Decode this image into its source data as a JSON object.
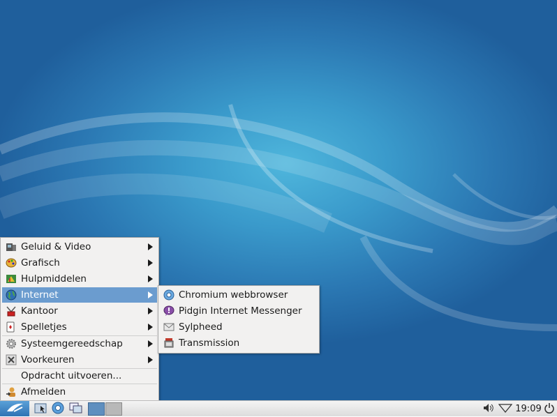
{
  "menu": {
    "items": [
      {
        "label": "Geluid & Video",
        "icon": "multimedia-icon",
        "submenu": true
      },
      {
        "label": "Grafisch",
        "icon": "graphics-icon",
        "submenu": true
      },
      {
        "label": "Hulpmiddelen",
        "icon": "accessories-icon",
        "submenu": true
      },
      {
        "label": "Internet",
        "icon": "internet-globe-icon",
        "submenu": true,
        "active": true
      },
      {
        "label": "Kantoor",
        "icon": "office-icon",
        "submenu": true
      },
      {
        "label": "Spelletjes",
        "icon": "games-icon",
        "submenu": true
      },
      {
        "label": "Systeemgereedschap",
        "icon": "system-tools-icon",
        "submenu": true
      },
      {
        "label": "Voorkeuren",
        "icon": "preferences-icon",
        "submenu": true
      },
      {
        "label": "Opdracht uitvoeren...",
        "icon": "",
        "submenu": false
      },
      {
        "label": "Afmelden",
        "icon": "logout-icon",
        "submenu": false
      }
    ]
  },
  "submenu": {
    "items": [
      {
        "label": "Chromium webbrowser",
        "icon": "chromium-icon"
      },
      {
        "label": "Pidgin Internet Messenger",
        "icon": "pidgin-icon"
      },
      {
        "label": "Sylpheed",
        "icon": "sylpheed-mail-icon"
      },
      {
        "label": "Transmission",
        "icon": "transmission-icon"
      }
    ]
  },
  "taskbar": {
    "clock": "19:09",
    "icons": [
      "start-menu-icon",
      "file-manager-icon",
      "chromium-icon",
      "desktop-switch-icon",
      "volume-icon",
      "network-icon",
      "power-icon"
    ]
  },
  "colors": {
    "desktop": "#2b78b3",
    "menu_bg": "#f2f1f0",
    "highlight": "#6b9ccf"
  }
}
